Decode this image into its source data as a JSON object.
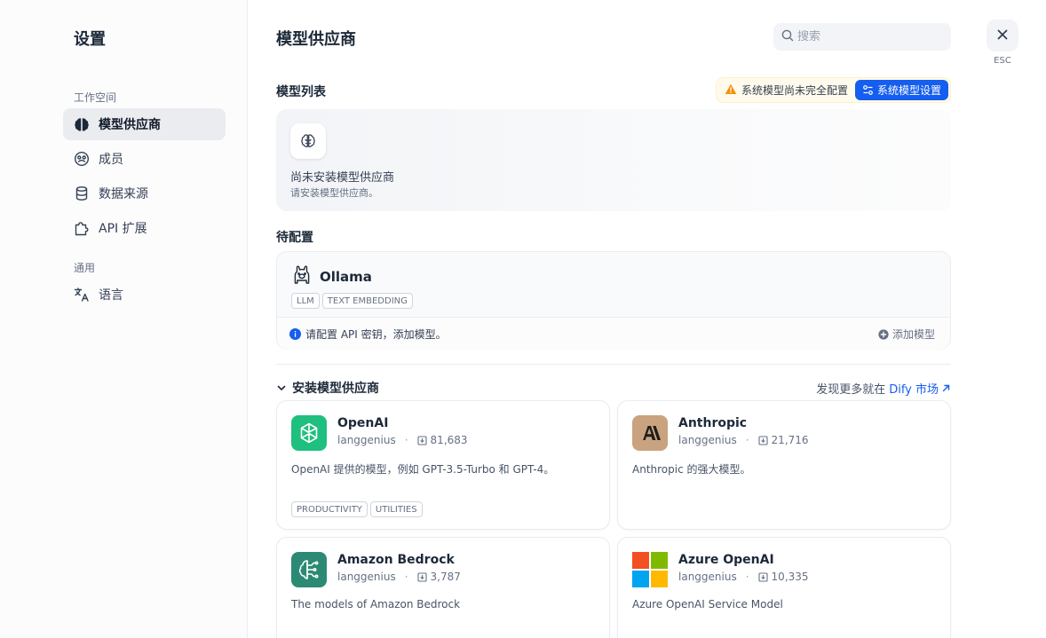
{
  "sidebar": {
    "title": "设置",
    "groups": [
      {
        "label": "工作空间"
      },
      {
        "label": "通用"
      }
    ],
    "items": [
      {
        "label": "模型供应商",
        "icon": "brain-icon"
      },
      {
        "label": "成员",
        "icon": "members-icon"
      },
      {
        "label": "数据来源",
        "icon": "database-icon"
      },
      {
        "label": "API 扩展",
        "icon": "puzzle-icon"
      },
      {
        "label": "语言",
        "icon": "translate-icon"
      }
    ]
  },
  "header": {
    "title": "模型供应商",
    "search_placeholder": "搜索",
    "close_hint": "ESC"
  },
  "model_list": {
    "title": "模型列表",
    "status_text": "系统模型尚未完全配置",
    "system_button": "系统模型设置",
    "empty_title": "尚未安装模型供应商",
    "empty_desc": "请安装模型供应商。"
  },
  "pending": {
    "title": "待配置",
    "provider": {
      "name": "Ollama",
      "tags": [
        "LLM",
        "TEXT EMBEDDING"
      ],
      "message": "请配置 API 密钥，添加模型。",
      "add_label": "添加模型"
    }
  },
  "install": {
    "title": "安装模型供应商",
    "market_prefix": "发现更多就在",
    "market_link": "Dify 市场"
  },
  "providers": [
    {
      "name": "OpenAI",
      "author": "langgenius",
      "downloads": "81,683",
      "desc": "OpenAI 提供的模型，例如 GPT-3.5-Turbo 和 GPT-4。",
      "tags": [
        "PRODUCTIVITY",
        "UTILITIES"
      ],
      "logo_color": "#1fbf7f"
    },
    {
      "name": "Anthropic",
      "author": "langgenius",
      "downloads": "21,716",
      "desc": "Anthropic 的强大模型。",
      "tags": [],
      "logo_color": "#c9a37f"
    },
    {
      "name": "Amazon Bedrock",
      "author": "langgenius",
      "downloads": "3,787",
      "desc": "The models of Amazon Bedrock",
      "tags": [],
      "logo_color": "#2c8a74"
    },
    {
      "name": "Azure OpenAI",
      "author": "langgenius",
      "downloads": "10,335",
      "desc": "Azure OpenAI Service Model",
      "tags": [],
      "logo_color": "#f25022"
    }
  ],
  "colors": {
    "accent": "#155eef",
    "warning": "#f79009",
    "info": "#155eef"
  }
}
